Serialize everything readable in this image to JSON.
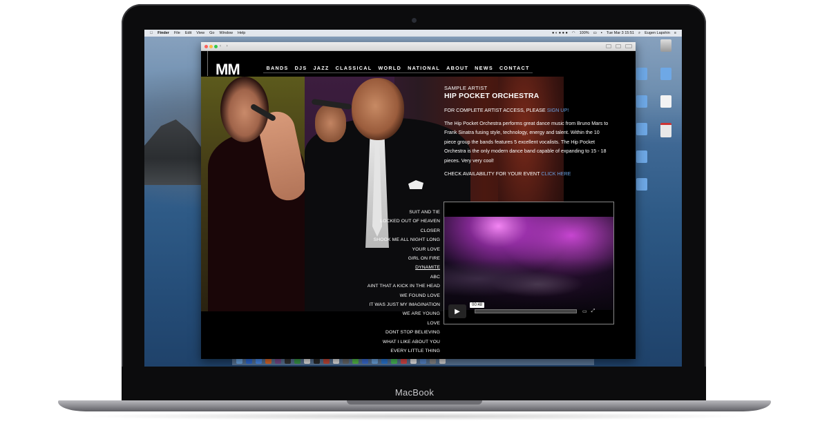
{
  "device": {
    "brand": "MacBook"
  },
  "menubar": {
    "app": "Finder",
    "items": [
      "File",
      "Edit",
      "View",
      "Go",
      "Window",
      "Help"
    ],
    "battery": "100%",
    "clock": "Tue Mar 3  15:51",
    "user": "Eugen Lapshin"
  },
  "site": {
    "logo": "MM",
    "nav": [
      "BANDS",
      "DJS",
      "JAZZ",
      "CLASSICAL",
      "WORLD",
      "NATIONAL",
      "ABOUT",
      "NEWS",
      "CONTACT"
    ],
    "artist": {
      "label": "SAMPLE ARTIST",
      "name": "HIP POCKET ORCHESTRA",
      "access_text": "FOR COMPLETE ARTIST ACCESS, PLEASE ",
      "access_link": "SIGN UP!",
      "description": "The Hip Pocket Orchestra performs great dance music from Bruno Mars to Frank Sinatra fusing style, technology, energy and talent. Within the 10 piece group the bands features 5 excellent vocalists. The Hip Pocket Orchestra is the only modern dance band capable of expanding to 15 - 18 pieces. Very very cool!",
      "availability_text": "CHECK AVAILABILITY FOR YOUR EVENT ",
      "availability_link": "CLICK HERE"
    },
    "songs": [
      "SUIT AND TIE",
      "LOCKED OUT OF HEAVEN",
      "CLOSER",
      "SHOOK ME ALL NIGHT LONG",
      "YOUR LOVE",
      "GIRL ON FIRE",
      "DYNAMITE",
      "ABC",
      "AINT THAT A KICK IN THE HEAD",
      "WE FOUND LOVE",
      "IT WAS JUST MY IMAGINATION",
      "WE ARE YOUNG",
      "LOVE",
      "DONT STOP BELIEVING",
      "WHAT I LIKE ABOUT YOU",
      "EVERY LITTLE THING"
    ],
    "active_song": "DYNAMITE",
    "video": {
      "time": "00:48"
    },
    "colors": {
      "link": "#6aa0e0",
      "background": "#000000",
      "text": "#ffffff"
    }
  }
}
